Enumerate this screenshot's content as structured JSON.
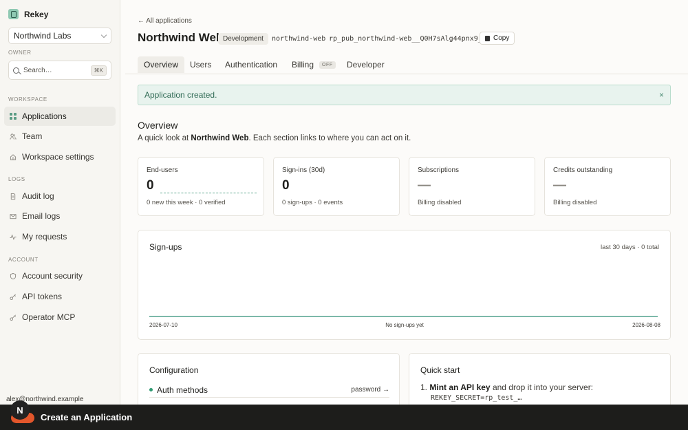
{
  "sidebar": {
    "brand": "Rekey",
    "org": "Northwind Labs",
    "owner_label": "OWNER",
    "search_placeholder": "Search…",
    "search_kbd": "⌘K",
    "workspace_label": "WORKSPACE",
    "logs_label": "LOGS",
    "account_label": "ACCOUNT",
    "items": [
      {
        "label": "Applications",
        "icon": "grid-icon",
        "active": true
      },
      {
        "label": "Team",
        "icon": "people-icon"
      },
      {
        "label": "Workspace settings",
        "icon": "home-icon"
      },
      {
        "label": "Audit log",
        "icon": "document-icon"
      },
      {
        "label": "Email logs",
        "icon": "mail-icon"
      },
      {
        "label": "My requests",
        "icon": "activity-icon"
      },
      {
        "label": "Account security",
        "icon": "shield-icon"
      },
      {
        "label": "API tokens",
        "icon": "key-icon"
      },
      {
        "label": "Operator MCP",
        "icon": "key-icon"
      }
    ],
    "user_email": "alex@northwind.example",
    "avatar_initial": "N"
  },
  "header": {
    "back_link": "← All applications",
    "title": "Northwind Web",
    "env_badge": "Development",
    "slug": "northwind-web",
    "public_key": "rp_pub_northwind-web__Q0H7sAlg44pnx9_",
    "copy_label": "Copy"
  },
  "tabs": [
    {
      "label": "Overview",
      "active": true
    },
    {
      "label": "Users"
    },
    {
      "label": "Authentication"
    },
    {
      "label": "Billing",
      "badge": "OFF"
    },
    {
      "label": "Developer"
    }
  ],
  "alert": {
    "text": "Application created.",
    "close": "×"
  },
  "overview": {
    "title": "Overview",
    "desc_prefix": "A quick look at ",
    "desc_app": "Northwind Web",
    "desc_suffix": ". Each section links to where you can act on it."
  },
  "stats": [
    {
      "label": "End-users",
      "value": "0",
      "sub": "0 new this week · 0 verified"
    },
    {
      "label": "Sign-ins (30d)",
      "value": "0",
      "sub": "0 sign-ups · 0 events"
    },
    {
      "label": "Subscriptions",
      "value": "—",
      "sub": "Billing disabled"
    },
    {
      "label": "Credits outstanding",
      "value": "—",
      "sub": "Billing disabled"
    }
  ],
  "chart_data": {
    "type": "line",
    "title": "Sign-ups",
    "meta": "last 30 days · 0 total",
    "x": [
      "2026-07-10",
      "2026-08-08"
    ],
    "start_label": "2026-07-10",
    "end_label": "2026-08-08",
    "center_label": "No sign-ups yet",
    "values": [
      0,
      0
    ],
    "color": "#2f8f78"
  },
  "configuration": {
    "title": "Configuration",
    "auth_label": "Auth methods",
    "auth_value": "password →"
  },
  "quickstart": {
    "title": "Quick start",
    "step_num": "1.",
    "step_bold": "Mint an API key",
    "step_rest": " and drop it into your server:",
    "code": "REKEY_SECRET=rp_test_…"
  },
  "bottom_bar": {
    "title": "Create an Application"
  }
}
